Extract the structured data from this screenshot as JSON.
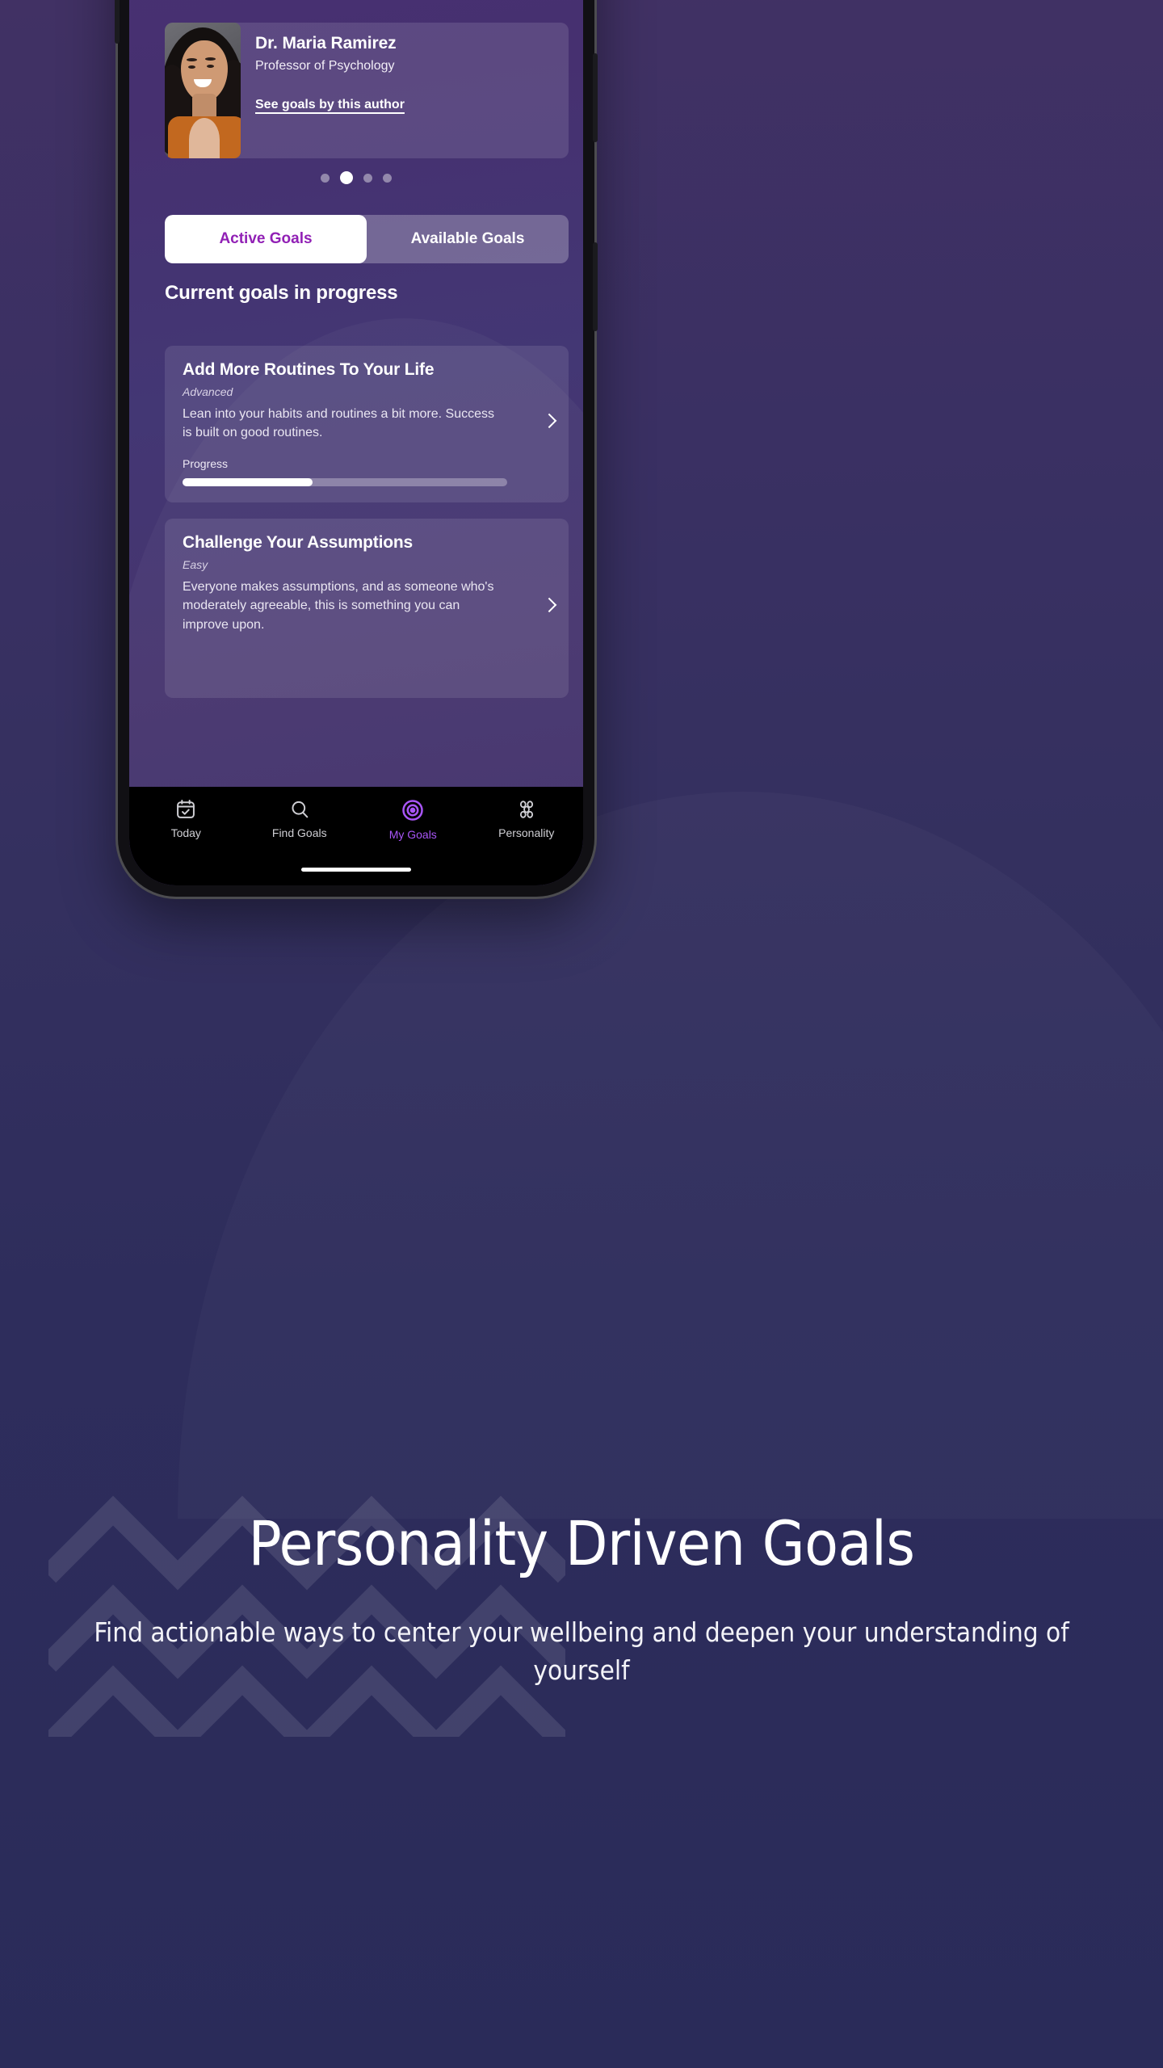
{
  "promo": {
    "title": "Personality Driven Goals",
    "subtitle": "Find actionable ways to center your wellbeing and deepen your understanding of yourself",
    "background_color": "#2b2e5e",
    "accent_color": "#a855f7"
  },
  "app": {
    "author_card": {
      "name": "Dr. Maria Ramirez",
      "role": "Professor of Psychology",
      "link_label": "See goals by this author",
      "avatar_alt": "author-portrait"
    },
    "carousel": {
      "total_dots": 4,
      "active_index": 1
    },
    "tabs": [
      {
        "label": "Active Goals",
        "active": true
      },
      {
        "label": "Available Goals",
        "active": false
      }
    ],
    "section_title": "Current goals in progress",
    "goals": [
      {
        "title": "Add More Routines To Your Life",
        "level": "Advanced",
        "description": "Lean into your habits and routines a bit more. Success is built on good routines.",
        "progress_label": "Progress",
        "progress_percent": 40
      },
      {
        "title": "Challenge Your Assumptions",
        "level": "Easy",
        "description": "Everyone makes assumptions, and as someone who's moderately agreeable, this is something you can improve upon."
      }
    ],
    "bottom_nav": [
      {
        "label": "Today",
        "icon": "calendar-check-icon",
        "active": false
      },
      {
        "label": "Find Goals",
        "icon": "search-icon",
        "active": false
      },
      {
        "label": "My Goals",
        "icon": "target-icon",
        "active": true
      },
      {
        "label": "Personality",
        "icon": "flower-cluster-icon",
        "active": false
      }
    ]
  }
}
